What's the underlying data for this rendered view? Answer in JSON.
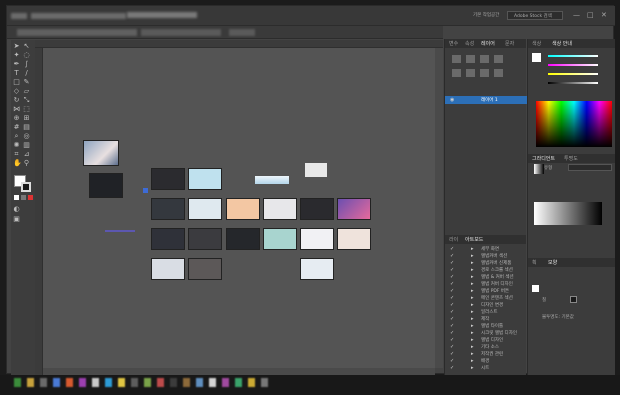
{
  "header": {
    "top_right_a": "기본 작업공간",
    "top_right_b": "Adobe Stock 검색",
    "window_min": "—",
    "window_max": "□",
    "window_close": "✕"
  },
  "panels": {
    "layers_tabs": [
      "변수",
      "속성",
      "레이어",
      "문자"
    ],
    "artboard_tabs": [
      "라이",
      "아트보드"
    ],
    "layer_names": [
      "레이어 1",
      "세부 화면",
      "앨범커버 섹션",
      "앨범커버 신제품",
      "경로 스크롤 섹션",
      "앨범 & 커버 섹션",
      "앨범 커버 디자인",
      "앨범 PDF 버튼",
      "메인 콘텐츠 섹션",
      "디자인 변경",
      "일러스트",
      "제작",
      "앨범 타이틀",
      "시크릿 앨범 디자인",
      "앨범 디자인",
      "기타 소스",
      "저작권 관련",
      "배경",
      "시트"
    ],
    "color_tabs": [
      "색상",
      "색상 안내"
    ],
    "gradient_tabs": [
      "그라디언트",
      "투명도"
    ],
    "gradient_type": "유형",
    "appearance_tabs": [
      "획",
      "모양"
    ],
    "appearance_rows": [
      "칠",
      "불투명도: 기본값"
    ]
  },
  "colors": {
    "app_bg": "#434343",
    "panel_bg": "#3c3c3c",
    "canvas_bg": "#545454",
    "accent_blue": "#2c6fb7"
  }
}
